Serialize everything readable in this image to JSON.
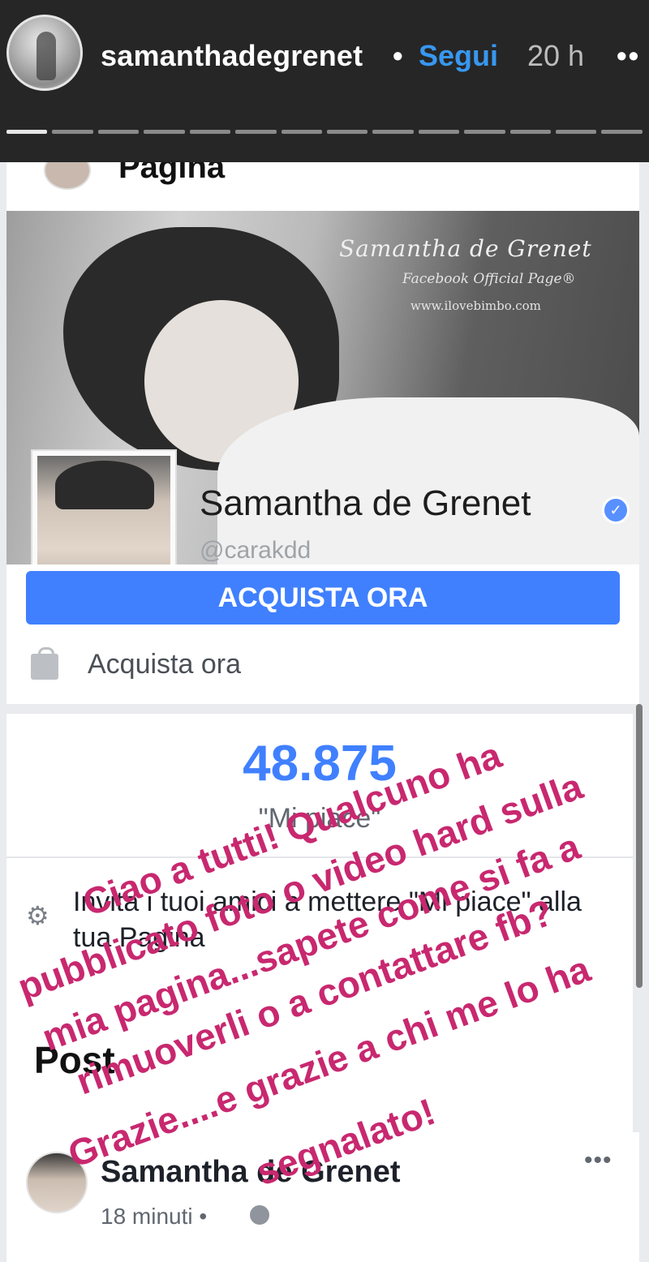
{
  "story": {
    "username": "samanthadegrenet",
    "separator": "•",
    "follow_label": "Segui",
    "time": "20 h",
    "more": "••",
    "progress": {
      "segments": 14,
      "active": 1
    }
  },
  "screenshot": {
    "page_heading": "Pagina",
    "cover": {
      "brand_line1": "Samantha de Grenet",
      "brand_line2": "Facebook Official Page®",
      "brand_line3": "www.ilovebimbo.com"
    },
    "page_name": "Samantha de Grenet",
    "verified_mark": "✓",
    "handle": "@carakdd",
    "cta_button": "ACQUISTA ORA",
    "shop_label": "Acquista ora",
    "likes_count": "48.875",
    "likes_label": "\"Mi piace\"",
    "invite_text": "Invita i tuoi amici a mettere \"Mi piace\" alla tua Pagina",
    "posts_title": "Post",
    "post": {
      "author": "Samantha de Grenet",
      "time": "18 minuti •",
      "more": "•••"
    }
  },
  "overlay": {
    "lines": [
      "Ciao a tutti! Qualcuno ha",
      "pubblicato foto o video hard sulla",
      "mia pagina...sapete come si fa a",
      "rimuoverli o a contattare fb?",
      "Grazie....e grazie a chi me lo ha",
      "segnalato!"
    ],
    "color": "#c8286f"
  },
  "colors": {
    "background": "#262626",
    "instagram_link": "#3897f0",
    "facebook_blue": "#4080ff"
  },
  "icons": [
    "avatar",
    "verified-badge-icon",
    "shopping-bag-icon",
    "friends-icon",
    "globe-icon",
    "more-dots-icon"
  ]
}
